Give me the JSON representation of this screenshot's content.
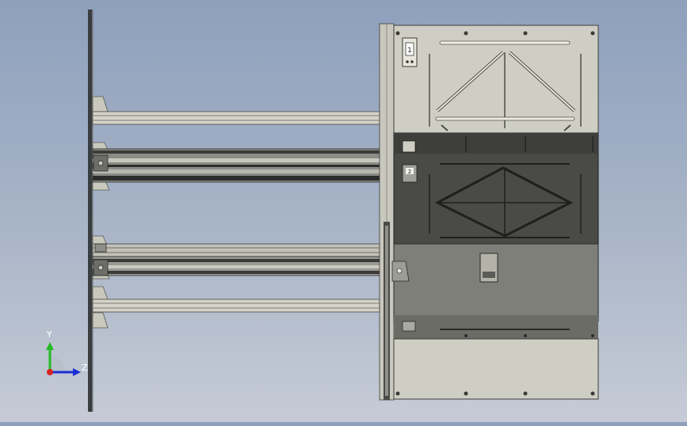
{
  "viewport": {
    "background_top": "#8ea0bc",
    "background_bottom": "#c6cbd6"
  },
  "labels": {
    "label_1": "1",
    "label_2": "2"
  },
  "triad": {
    "y_label": "Y",
    "z_label": "Z",
    "y_color": "#22bb22",
    "z_color": "#1a2fd6",
    "origin_color": "#d42222"
  }
}
